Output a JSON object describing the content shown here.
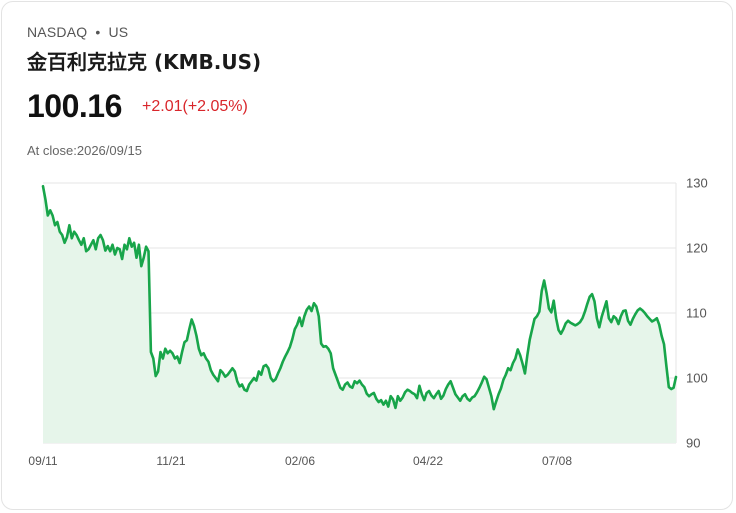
{
  "header": {
    "exchange": "NASDAQ",
    "separator": "•",
    "market": "US",
    "name": "金百利克拉克 (KMB.US)",
    "price": "100.16",
    "change": "+2.01(+2.05%)",
    "close_label": "At close:",
    "close_date": "2026/09/15"
  },
  "colors": {
    "line": "#18a54a",
    "fill": "#e6f5ea",
    "change": "#d9262b",
    "grid": "#e6e6e6"
  },
  "chart_data": {
    "type": "area",
    "x_ticks": [
      "09/11",
      "11/21",
      "02/06",
      "04/22",
      "07/08"
    ],
    "y_ticks": [
      90,
      100,
      110,
      120,
      130
    ],
    "ylim": [
      90,
      130
    ],
    "y_axis_position": "right",
    "grid": true,
    "values": [
      129.5,
      127.5,
      125,
      125.8,
      125,
      123.5,
      124,
      122.5,
      122,
      120.8,
      121.7,
      123.5,
      121.5,
      122.5,
      122,
      121.2,
      120.5,
      121.5,
      119.5,
      119.8,
      120.5,
      121.2,
      119.8,
      121.5,
      122,
      121.2,
      119.6,
      120.3,
      119.5,
      120.5,
      119,
      120,
      119.8,
      118.3,
      120.5,
      119.8,
      121.5,
      120.2,
      120.8,
      118.5,
      120.5,
      117.2,
      118.5,
      120.2,
      119.5,
      104,
      103,
      100.3,
      101,
      104,
      103,
      104.5,
      103.8,
      104.2,
      103.8,
      103,
      103.3,
      102.3,
      104,
      105.5,
      105.8,
      107.5,
      109,
      108,
      106.5,
      104.5,
      103.5,
      103.8,
      103,
      102.5,
      101.2,
      100.5,
      100,
      99.5,
      101.2,
      100.8,
      100.2,
      100.5,
      101,
      101.5,
      101,
      99.5,
      98.7,
      99,
      98.2,
      98,
      99,
      99.5,
      100,
      99.6,
      101,
      100.5,
      101.8,
      102,
      101.5,
      100,
      99.5,
      99.8,
      100.7,
      101.5,
      102.5,
      103.3,
      104,
      104.8,
      106,
      107.5,
      108.2,
      109.3,
      108,
      109.5,
      110.5,
      111,
      110.3,
      111.5,
      111,
      109.5,
      105.3,
      104.8,
      104.9,
      104.5,
      103.8,
      101.5,
      100.5,
      99.5,
      98.5,
      98.2,
      99,
      99.3,
      98.7,
      98.5,
      99.5,
      99.2,
      99.6,
      99,
      98.6,
      97.6,
      97.2,
      97.5,
      97.7,
      96.8,
      96.3,
      96.6,
      95.9,
      96.5,
      95.6,
      97.2,
      96.7,
      95.4,
      97.2,
      96.5,
      97,
      97.8,
      98.2,
      98,
      97.7,
      97.5,
      96.9,
      98.8,
      97.5,
      96.6,
      97.7,
      98,
      97.3,
      96.9,
      97.5,
      98,
      96.8,
      97.3,
      98.3,
      99,
      99.5,
      98.5,
      97.5,
      97,
      96.5,
      97.2,
      97.5,
      96.8,
      96.5,
      97,
      97.2,
      97.8,
      98.5,
      99.3,
      100.2,
      99.8,
      98.5,
      97.2,
      95.2,
      96.4,
      97.5,
      98.4,
      99.7,
      100.5,
      101.5,
      101.2,
      102.3,
      103,
      104.4,
      103.5,
      102.2,
      100.7,
      103.5,
      105.9,
      107.5,
      109.1,
      109.5,
      110.2,
      113.4,
      115,
      113.1,
      110.7,
      110.1,
      111.9,
      109.2,
      107.4,
      106.8,
      107.5,
      108.4,
      108.8,
      108.5,
      108.3,
      108.1,
      108.3,
      108.6,
      109.2,
      110.2,
      111.4,
      112.5,
      112.9,
      111.8,
      109.2,
      107.8,
      109.4,
      110.6,
      111.8,
      109.2,
      108.6,
      109.5,
      109.2,
      108.3,
      109.5,
      110.3,
      110.4,
      108.8,
      108.2,
      109.1,
      109.8,
      110.4,
      110.7,
      110.4,
      110,
      109.5,
      109.1,
      108.7,
      108.9,
      109.2,
      108.2,
      106.5,
      105.2,
      101.8,
      98.6,
      98.3,
      98.5,
      100.16
    ]
  }
}
